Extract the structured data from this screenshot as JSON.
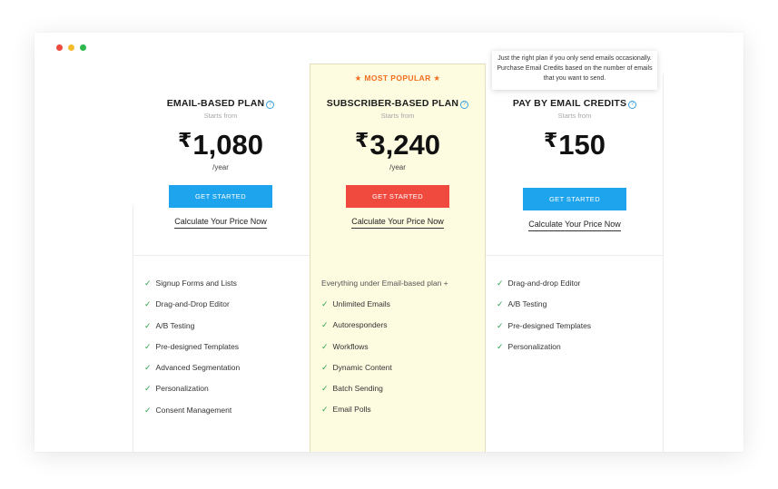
{
  "window": {
    "dots": [
      "#ee4a3e",
      "#f5bb2a",
      "#2eb84b"
    ]
  },
  "popular_label": "★ MOST POPULAR ★",
  "tooltip": "Just the right plan if you only send emails occasionally. Purchase Email Credits based on the number of emails that you want to send.",
  "plans": [
    {
      "name": "EMAIL-BASED PLAN",
      "starts_from": "Starts from",
      "currency": "₹",
      "price": "1,080",
      "period": "/year",
      "cta": "GET STARTED",
      "calc_link": "Calculate Your Price Now",
      "features": [
        "Signup Forms and Lists",
        "Drag-and-Drop Editor",
        "A/B Testing",
        "Pre-designed Templates",
        "Advanced Segmentation",
        "Personalization",
        "Consent Management"
      ]
    },
    {
      "name": "SUBSCRIBER-BASED PLAN",
      "starts_from": "Starts from",
      "currency": "₹",
      "price": "3,240",
      "period": "/year",
      "cta": "GET STARTED",
      "calc_link": "Calculate Your Price Now",
      "intro": "Everything under Email-based plan +",
      "features": [
        "Unlimited Emails",
        "Autoresponders",
        "Workflows",
        "Dynamic Content",
        "Batch Sending",
        "Email Polls"
      ]
    },
    {
      "name": "PAY BY EMAIL CREDITS",
      "starts_from": "Starts from",
      "currency": "₹",
      "price": "150",
      "period": "",
      "cta": "GET STARTED",
      "calc_link": "Calculate Your Price Now",
      "features": [
        "Drag-and-drop Editor",
        "A/B Testing",
        "Pre-designed Templates",
        "Personalization"
      ]
    }
  ],
  "icons": {
    "check": "✓",
    "help": "?"
  },
  "colors": {
    "accent_blue": "#1ea4ec",
    "accent_red": "#f04a3f",
    "popular_bg": "#fdfbe0",
    "check_green": "#2ea44f",
    "popular_text": "#f26f1e"
  }
}
